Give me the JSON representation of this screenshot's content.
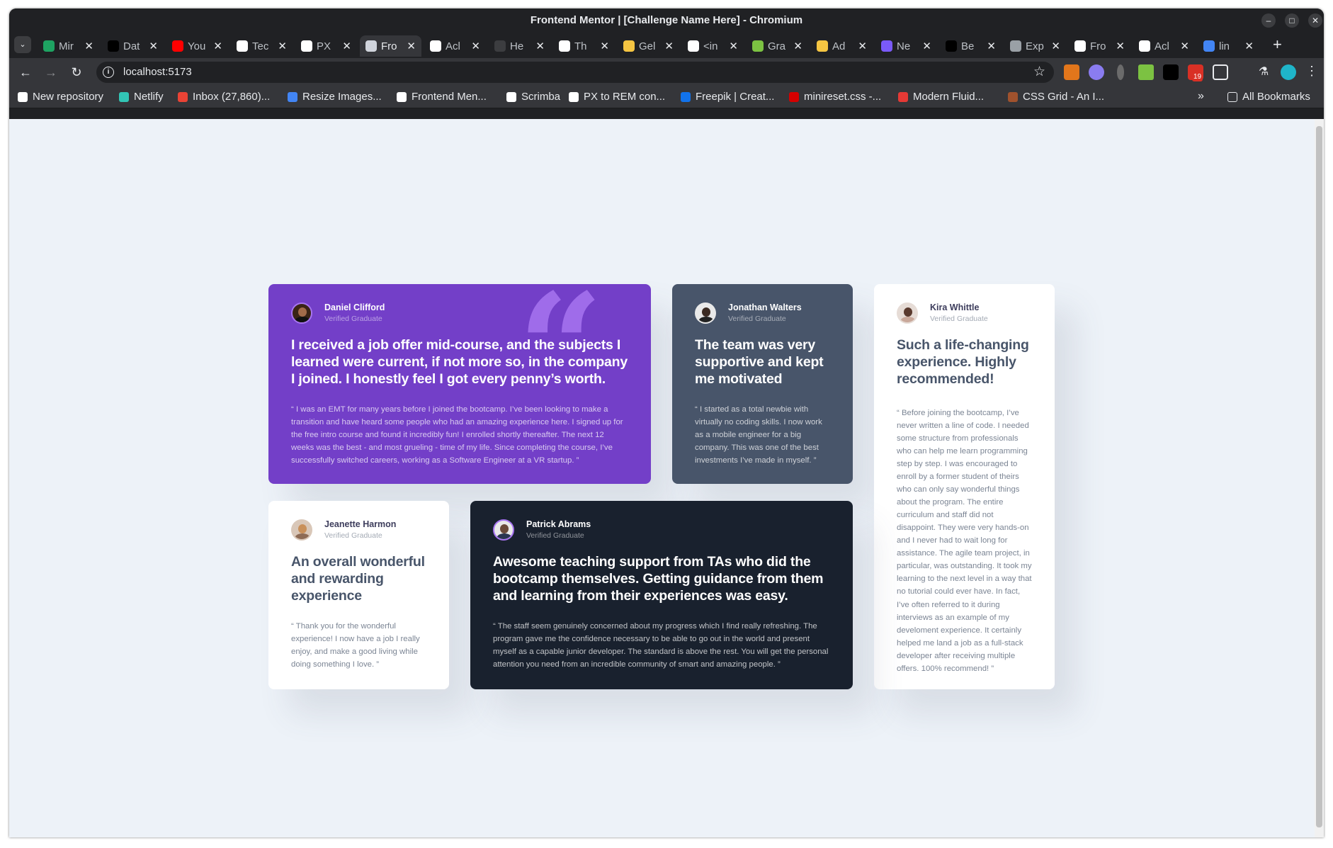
{
  "window": {
    "title": "Frontend Mentor | [Challenge Name Here] - Chromium"
  },
  "tabs": [
    {
      "label": "Mir",
      "color": "#1ea362"
    },
    {
      "label": "Dat",
      "color": "#000000"
    },
    {
      "label": "You",
      "color": "#ff0000"
    },
    {
      "label": "Tec",
      "color": "#ffffff"
    },
    {
      "label": "PX",
      "color": "#ffffff"
    },
    {
      "label": "Fro",
      "color": "#d0d4dc",
      "active": true
    },
    {
      "label": "Acl",
      "color": "#ffffff"
    },
    {
      "label": "He",
      "color": "#3c3d40"
    },
    {
      "label": "Th",
      "color": "#ffffff"
    },
    {
      "label": "Gel",
      "color": "#f5c542"
    },
    {
      "label": "<in",
      "color": "#ffffff"
    },
    {
      "label": "Gra",
      "color": "#7cc242"
    },
    {
      "label": "Ad",
      "color": "#f5c542"
    },
    {
      "label": "Ne",
      "color": "#7a5af8"
    },
    {
      "label": "Be",
      "color": "#000000"
    },
    {
      "label": "Exp",
      "color": "#9aa0a6"
    },
    {
      "label": "Fro",
      "color": "#ffffff"
    },
    {
      "label": "Acl",
      "color": "#ffffff"
    },
    {
      "label": "lin",
      "color": "#4285f4"
    }
  ],
  "toolbar": {
    "url": "localhost:5173",
    "ext_badge": "19"
  },
  "bookmarks": {
    "items": [
      {
        "label": "New repository",
        "color": "#ffffff"
      },
      {
        "label": "Netlify",
        "color": "#32c5b5"
      },
      {
        "label": "Inbox (27,860)...",
        "color": "#ea4335"
      },
      {
        "label": "Resize Images...",
        "color": "#4285f4"
      },
      {
        "label": "Frontend Men...",
        "color": "#ffffff"
      },
      {
        "label": "Scrimba",
        "color": "#ffffff"
      },
      {
        "label": "PX to REM con...",
        "color": "#ffffff"
      },
      {
        "label": "Freepik | Creat...",
        "color": "#1273eb"
      },
      {
        "label": "minireset.css -...",
        "color": "#d50000"
      },
      {
        "label": "Modern Fluid...",
        "color": "#e53935"
      },
      {
        "label": "CSS Grid - An I...",
        "color": "#a0522d"
      }
    ],
    "all_label": "All Bookmarks"
  },
  "testimonials": [
    {
      "name": "Daniel Clifford",
      "role": "Verified Graduate",
      "headline": "I received a job offer mid-course, and the subjects I learned were current, if not more so, in the company I joined. I honestly feel I got every penny’s worth.",
      "quote": "“ I was an EMT for many years before I joined the bootcamp. I’ve been looking to make a transition and have heard some people who had an amazing experience here. I signed up for the free intro course and found it incredibly fun! I enrolled shortly thereafter. The next 12 weeks was the best - and most grueling - time of my life. Since completing the course, I’ve successfully switched careers, working as a Software Engineer at a VR startup. ”",
      "theme": "#733fc8"
    },
    {
      "name": "Jonathan Walters",
      "role": "Verified Graduate",
      "headline": "The team was very supportive and kept me motivated",
      "quote": "“ I started as a total newbie with virtually no coding skills. I now work as a mobile engineer for a big company. This was one of the best investments I’ve made in myself. ”",
      "theme": "#48556a"
    },
    {
      "name": "Kira Whittle",
      "role": "Verified Graduate",
      "headline": "Such a life-changing experience. Highly recommended!",
      "quote": "“ Before joining the bootcamp, I’ve never written a line of code. I needed some structure from professionals who can help me learn programming step by step. I was encouraged to enroll by a former student of theirs who can only say wonderful things about the program. The entire curriculum and staff did not disappoint. They were very hands-on and I never had to wait long for assistance. The agile team project, in particular, was outstanding. It took my learning to the next level in a way that no tutorial could ever have. In fact, I’ve often referred to it during interviews as an example of my develoment experience. It certainly helped me land a job as a full-stack developer after receiving multiple offers. 100% recommend! ”",
      "theme": "#ffffff"
    },
    {
      "name": "Jeanette Harmon",
      "role": "Verified Graduate",
      "headline": "An overall wonderful and rewarding experience",
      "quote": "“ Thank you for the wonderful experience! I now have a job I really enjoy, and make a good living while doing something I love. ”",
      "theme": "#ffffff"
    },
    {
      "name": "Patrick Abrams",
      "role": "Verified Graduate",
      "headline": "Awesome teaching support from TAs who did the bootcamp themselves. Getting guidance from them and learning from their experiences was easy.",
      "quote": "“ The staff seem genuinely concerned about my progress which I find really refreshing. The program gave me the confidence necessary to be able to go out in the world and present myself as a capable junior developer. The standard is above the rest. You will get the personal attention you need from an incredible community of smart and amazing people. ”",
      "theme": "#19212e"
    }
  ]
}
